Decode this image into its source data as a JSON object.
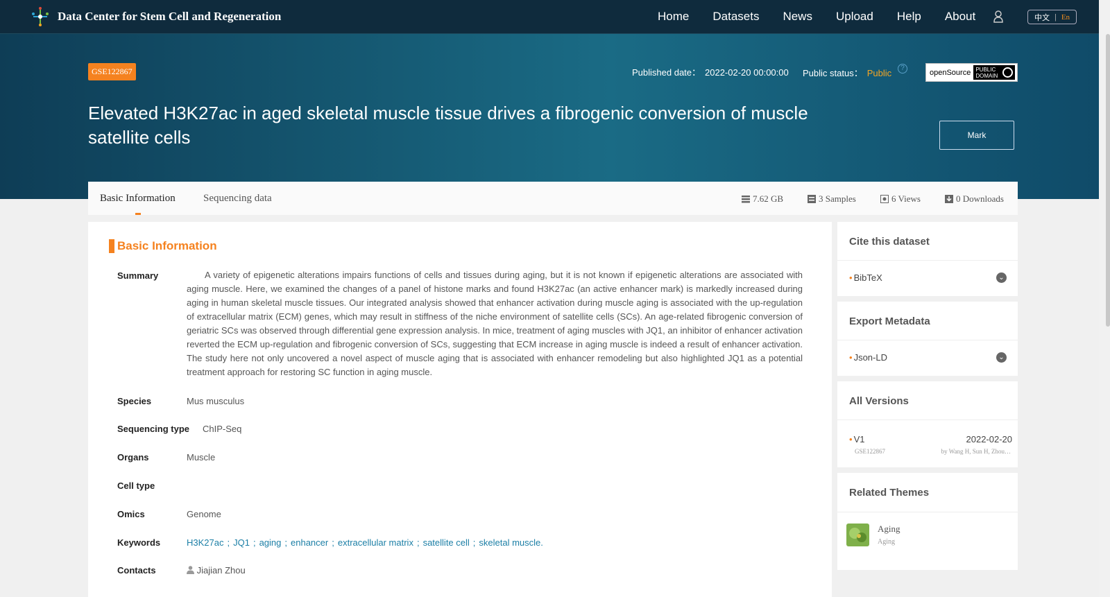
{
  "header": {
    "brand": "Data Center for Stem Cell and Regeneration",
    "nav": [
      "Home",
      "Datasets",
      "News",
      "Upload",
      "Help",
      "About"
    ],
    "lang_zh": "中文",
    "lang_en": "En"
  },
  "hero": {
    "accession": "GSE122867",
    "published_label": "Published date：",
    "published_value": "2022-02-20 00:00:00",
    "status_label": "Public status：",
    "status_value": "Public",
    "opensource_label": "openSource",
    "license_line1": "PUBLIC",
    "license_line2": "DOMAIN",
    "title": "Elevated H3K27ac in aged skeletal muscle tissue drives a fibrogenic conversion of muscle satellite cells",
    "mark_label": "Mark"
  },
  "tabs": {
    "basic": "Basic Information",
    "sequencing": "Sequencing data"
  },
  "stats": {
    "size": "7.62 GB",
    "samples": "3 Samples",
    "views": "6 Views",
    "downloads": "0 Downloads"
  },
  "basic": {
    "heading": "Basic Information",
    "summary_label": "Summary",
    "summary": "A variety of epigenetic alterations impairs functions of cells and tissues during aging, but it is not known if epigenetic alterations are associated with aging muscle. Here, we examined the changes of a panel of histone marks and found H3K27ac (an active enhancer mark) is markedly increased during aging in human skeletal muscle tissues. Our integrated analysis showed that enhancer activation during muscle aging is associated with the up-regulation of extracellular matrix (ECM) genes, which may result in stiffness of the niche environment of satellite cells (SCs). An age-related fibrogenic conversion of geriatric SCs was observed through differential gene expression analysis. In mice, treatment of aging muscles with JQ1, an inhibitor of enhancer activation reverted the ECM up-regulation and fibrogenic conversion of SCs, suggesting that ECM increase in aging muscle is indeed a result of enhancer activation. The study here not only uncovered a novel aspect of muscle aging that is associated with enhancer remodeling but also highlighted JQ1 as a potential treatment approach for restoring SC function in aging muscle.",
    "species_label": "Species",
    "species": "Mus musculus",
    "seqtype_label": "Sequencing type",
    "seqtype": "ChIP-Seq",
    "organs_label": "Organs",
    "organs": "Muscle",
    "celltype_label": "Cell type",
    "celltype": "",
    "omics_label": "Omics",
    "omics": "Genome",
    "keywords_label": "Keywords",
    "keywords": [
      "H3K27ac",
      "JQ1",
      "aging",
      "enhancer",
      "extracellular matrix",
      "satellite cell",
      "skeletal muscle."
    ],
    "contacts_label": "Contacts",
    "contact": "Jiajian Zhou"
  },
  "side": {
    "cite_heading": "Cite this dataset",
    "cite_item": "BibTeX",
    "export_heading": "Export Metadata",
    "export_item": "Json-LD",
    "versions_heading": "All Versions",
    "version_name": "V1",
    "version_date": "2022-02-20",
    "version_id": "GSE122867",
    "version_authors": "by Wang H, Sun H, Zhou…",
    "themes_heading": "Related Themes",
    "theme_title": "Aging",
    "theme_sub": "Aging"
  },
  "colors": {
    "accent": "#f5821f",
    "nav_bg": "#0f2b3d",
    "link": "#1c7fa6"
  }
}
